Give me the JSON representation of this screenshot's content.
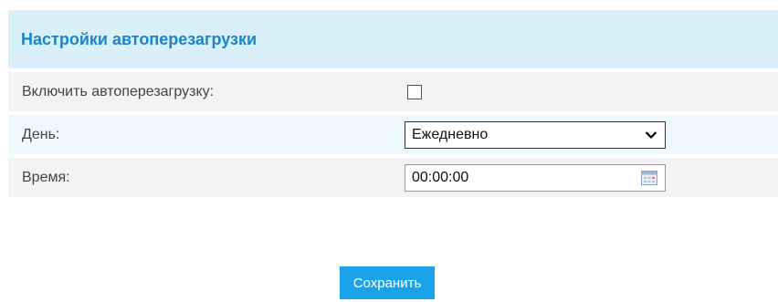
{
  "panel": {
    "title": "Настройки автоперезагрузки"
  },
  "fields": {
    "enable": {
      "label": "Включить автоперезагрузку:",
      "checked": false
    },
    "day": {
      "label": "День:",
      "value": "Ежедневно"
    },
    "time": {
      "label": "Время:",
      "value": "00:00:00"
    }
  },
  "actions": {
    "save_label": "Сохранить"
  },
  "icons": {
    "dropdown": "chevron-down-icon",
    "time_picker": "calendar-icon"
  },
  "colors": {
    "header_bg": "#d9f0fa",
    "title": "#1a86c8",
    "button_bg": "#1aa3e8"
  }
}
